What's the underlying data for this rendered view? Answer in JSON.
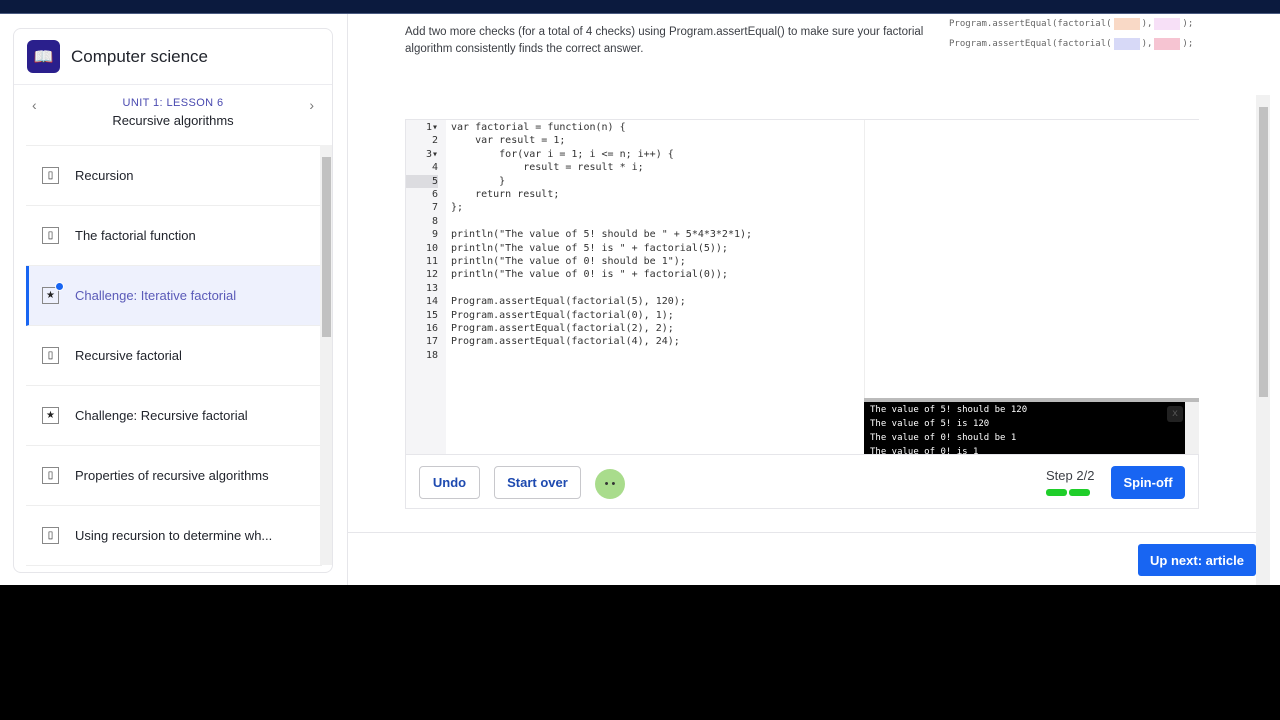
{
  "sidebar": {
    "course_title": "Computer science",
    "unit": "UNIT 1: LESSON 6",
    "lesson": "Recursive algorithms",
    "items": [
      {
        "label": "Recursion",
        "icon": "article-icon",
        "active": false
      },
      {
        "label": "The factorial function",
        "icon": "article-icon",
        "active": false
      },
      {
        "label": "Challenge: Iterative factorial",
        "icon": "star-icon",
        "active": true
      },
      {
        "label": "Recursive factorial",
        "icon": "article-icon",
        "active": false
      },
      {
        "label": "Challenge: Recursive factorial",
        "icon": "star-icon",
        "active": false
      },
      {
        "label": "Properties of recursive algorithms",
        "icon": "article-icon",
        "active": false
      },
      {
        "label": "Using recursion to determine wh...",
        "icon": "article-icon",
        "active": false
      }
    ]
  },
  "instructions": "Add two more checks (for a total of 4 checks) using Program.assertEqual() to make sure your factorial algorithm consistently finds the correct answer.",
  "hints": [
    {
      "prefix": "Program.assertEqual(factorial(",
      "mid": "),",
      "suffix": ");",
      "colors": [
        "#f9d9c6",
        "#f7e0f7"
      ]
    },
    {
      "prefix": "Program.assertEqual(factorial(",
      "mid": "),",
      "suffix": ");",
      "colors": [
        "#d7d9f7",
        "#f6c4d2"
      ]
    }
  ],
  "code": [
    {
      "n": "1▾",
      "text": "var factorial = function(n) {"
    },
    {
      "n": "2",
      "text": "    var result = 1;"
    },
    {
      "n": "3▾",
      "text": "        for(var i = 1; i <= n; i++) {"
    },
    {
      "n": "4",
      "text": "            result = result * i;"
    },
    {
      "n": "5",
      "text": "        }"
    },
    {
      "n": "6",
      "text": "    return result;"
    },
    {
      "n": "7",
      "text": "};"
    },
    {
      "n": "8",
      "text": ""
    },
    {
      "n": "9",
      "text": "println(\"The value of 5! should be \" + 5*4*3*2*1);"
    },
    {
      "n": "10",
      "text": "println(\"The value of 5! is \" + factorial(5));"
    },
    {
      "n": "11",
      "text": "println(\"The value of 0! should be 1\");"
    },
    {
      "n": "12",
      "text": "println(\"The value of 0! is \" + factorial(0));"
    },
    {
      "n": "13",
      "text": ""
    },
    {
      "n": "14",
      "text": "Program.assertEqual(factorial(5), 120);"
    },
    {
      "n": "15",
      "text": "Program.assertEqual(factorial(0), 1);"
    },
    {
      "n": "16",
      "text": "Program.assertEqual(factorial(2), 2);"
    },
    {
      "n": "17",
      "text": "Program.assertEqual(factorial(4), 24);"
    },
    {
      "n": "18",
      "text": ""
    }
  ],
  "console": [
    "The value of 5! should be 120",
    "The value of 5! is 120",
    "The value of 0! should be 1",
    "The value of 0! is 1"
  ],
  "console_close": "x",
  "toolbar": {
    "undo": "Undo",
    "start_over": "Start over",
    "step": "Step 2/2",
    "progress": {
      "done": 2,
      "total": 2
    },
    "spinoff": "Spin-off"
  },
  "up_next": "Up next: article",
  "colors": {
    "accent": "#1865f2",
    "topbar": "#0b1a3e",
    "progress": "#1fce2a"
  }
}
